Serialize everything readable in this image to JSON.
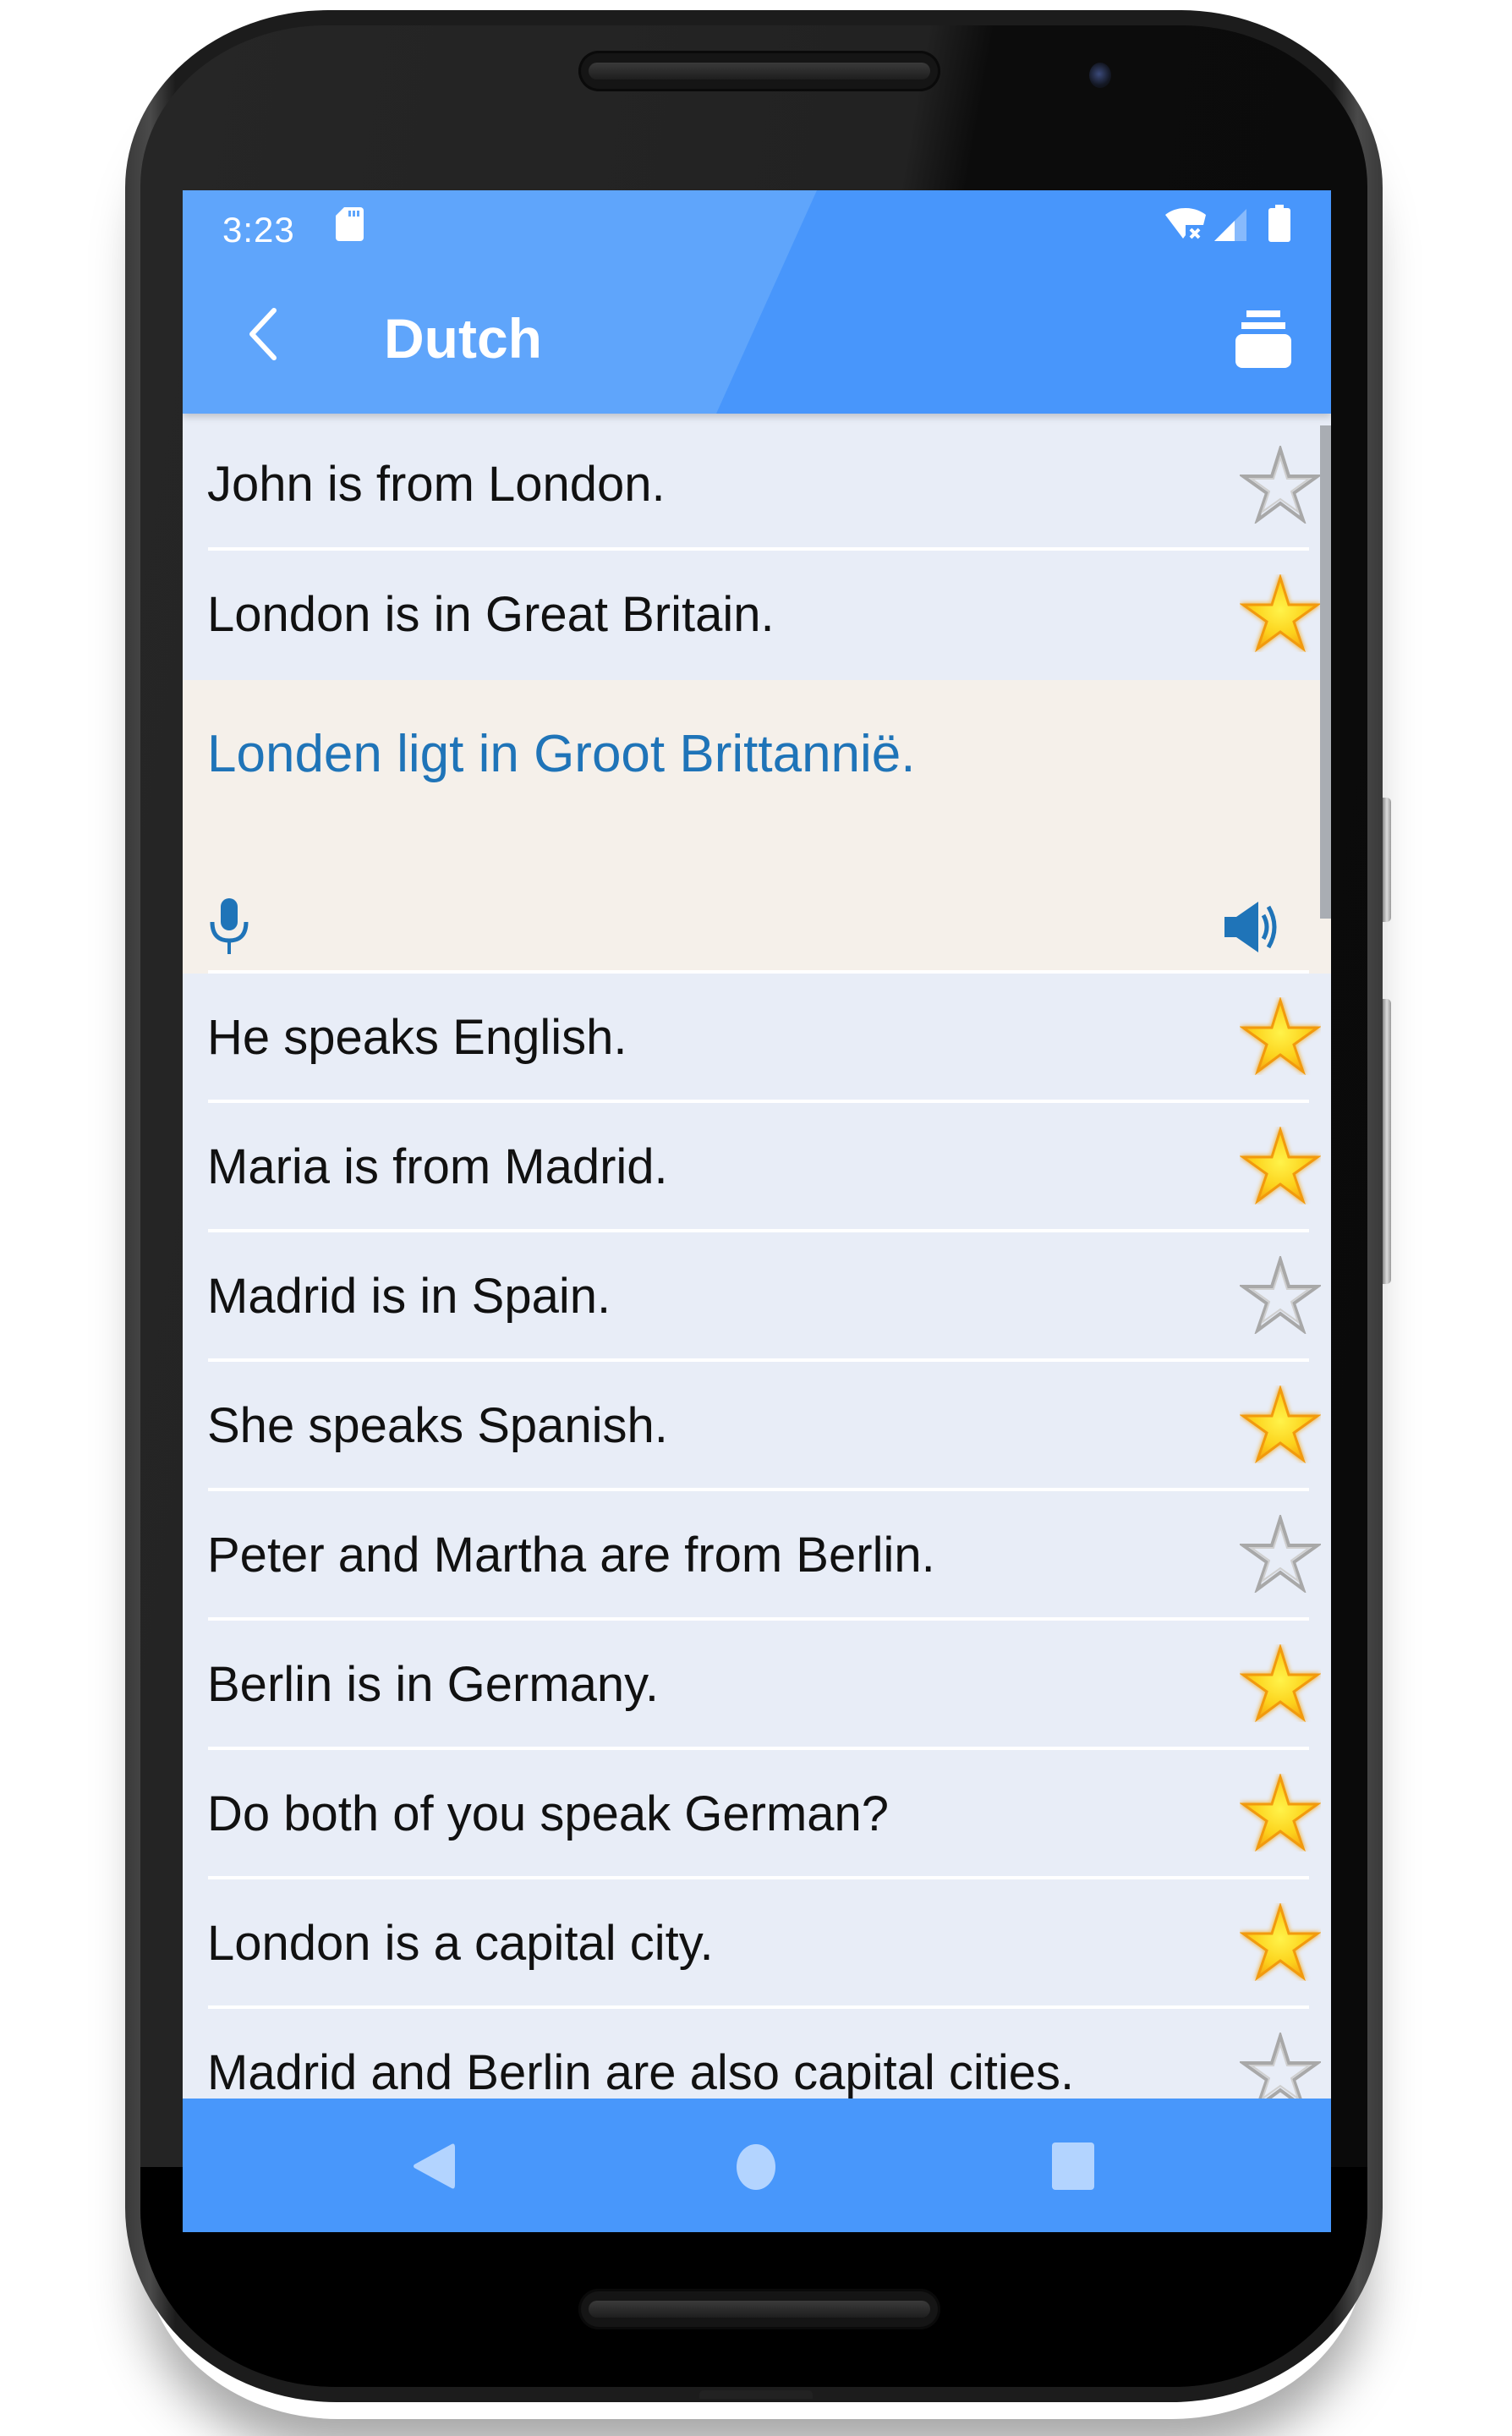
{
  "status_bar": {
    "time": "3:23",
    "icons": [
      "sd-card-icon",
      "wifi-off-icon",
      "cell-signal-icon",
      "battery-icon"
    ]
  },
  "app_bar": {
    "title": "Dutch",
    "back_icon": "chevron-left-icon",
    "action_icon": "stack-icon"
  },
  "colors": {
    "primary": "#4896fb",
    "list_background": "#e8edf7",
    "expanded_background": "#f5f0ea",
    "translation_text": "#1f74b8",
    "star_filled": "#f7c51c",
    "star_empty": "#b5b5b5"
  },
  "phrases": [
    {
      "text": "John is from London.",
      "starred": false
    },
    {
      "text": "London is in Great Britain.",
      "starred": true,
      "expanded": true,
      "translation": "Londen ligt in Groot Brittannië.",
      "actions": [
        "microphone-icon",
        "speaker-icon"
      ]
    },
    {
      "text": "He speaks English.",
      "starred": true
    },
    {
      "text": "Maria is from Madrid.",
      "starred": true
    },
    {
      "text": "Madrid is in Spain.",
      "starred": false
    },
    {
      "text": "She speaks Spanish.",
      "starred": true
    },
    {
      "text": "Peter and Martha are from Berlin.",
      "starred": false
    },
    {
      "text": "Berlin is in Germany.",
      "starred": true
    },
    {
      "text": "Do both of you speak German?",
      "starred": true
    },
    {
      "text": "London is a capital city.",
      "starred": true
    },
    {
      "text": "Madrid and Berlin are also capital cities.",
      "starred": false
    }
  ],
  "nav_bar": {
    "buttons": [
      "back-icon",
      "home-icon",
      "recents-icon"
    ]
  }
}
